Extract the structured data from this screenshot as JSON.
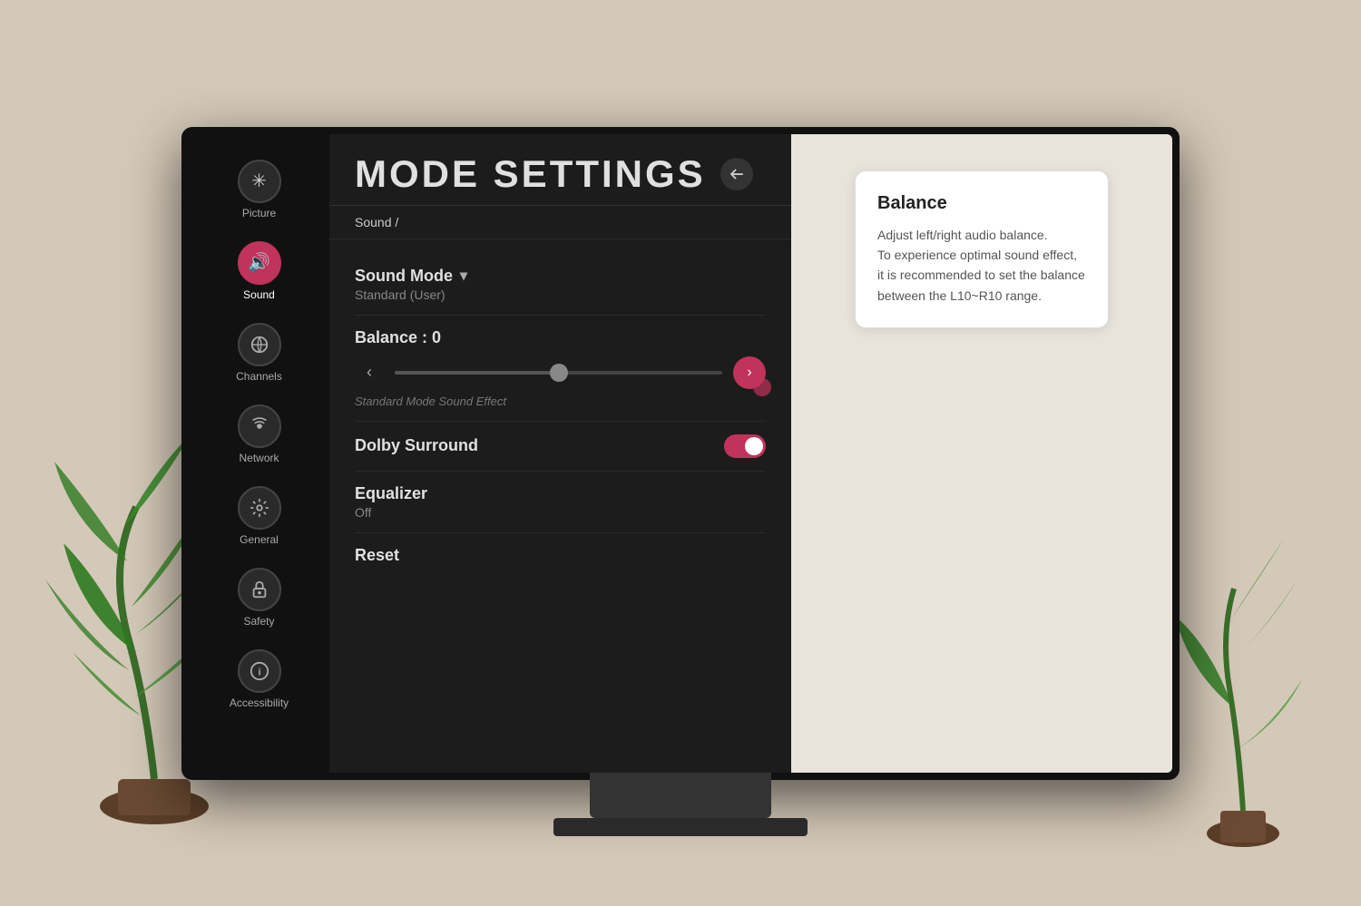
{
  "page": {
    "title": "MODE SETTINGS",
    "back_button_label": "↩"
  },
  "sidebar": {
    "items": [
      {
        "id": "picture",
        "label": "Picture",
        "icon": "✳",
        "active": false
      },
      {
        "id": "sound",
        "label": "Sound",
        "icon": "🔊",
        "active": true
      },
      {
        "id": "channels",
        "label": "Channels",
        "icon": "📡",
        "active": false
      },
      {
        "id": "network",
        "label": "Network",
        "icon": "🌐",
        "active": false
      },
      {
        "id": "general",
        "label": "General",
        "icon": "⚙",
        "active": false
      },
      {
        "id": "safety",
        "label": "Safety",
        "icon": "🔒",
        "active": false
      },
      {
        "id": "accessibility",
        "label": "Accessibility",
        "icon": "ⓘ",
        "active": false
      }
    ]
  },
  "breadcrumb": "Sound /",
  "settings": {
    "sound_mode": {
      "label": "Sound Mode",
      "value": "Standard (User)"
    },
    "balance": {
      "label": "Balance : 0",
      "subtitle": "Standard Mode Sound Effect",
      "value": 0,
      "min": -10,
      "max": 10
    },
    "dolby_surround": {
      "label": "Dolby Surround",
      "enabled": true
    },
    "equalizer": {
      "label": "Equalizer",
      "value": "Off"
    },
    "reset": {
      "label": "Reset"
    }
  },
  "info_card": {
    "title": "Balance",
    "text": "Adjust left/right audio balance.\nTo experience optimal sound effect, it is recommended to set the balance between the L10~R10 range."
  },
  "colors": {
    "accent": "#c0335a",
    "bg_dark": "#1c1c1c",
    "sidebar_bg": "#111111",
    "right_panel_bg": "#e8e4dc"
  }
}
